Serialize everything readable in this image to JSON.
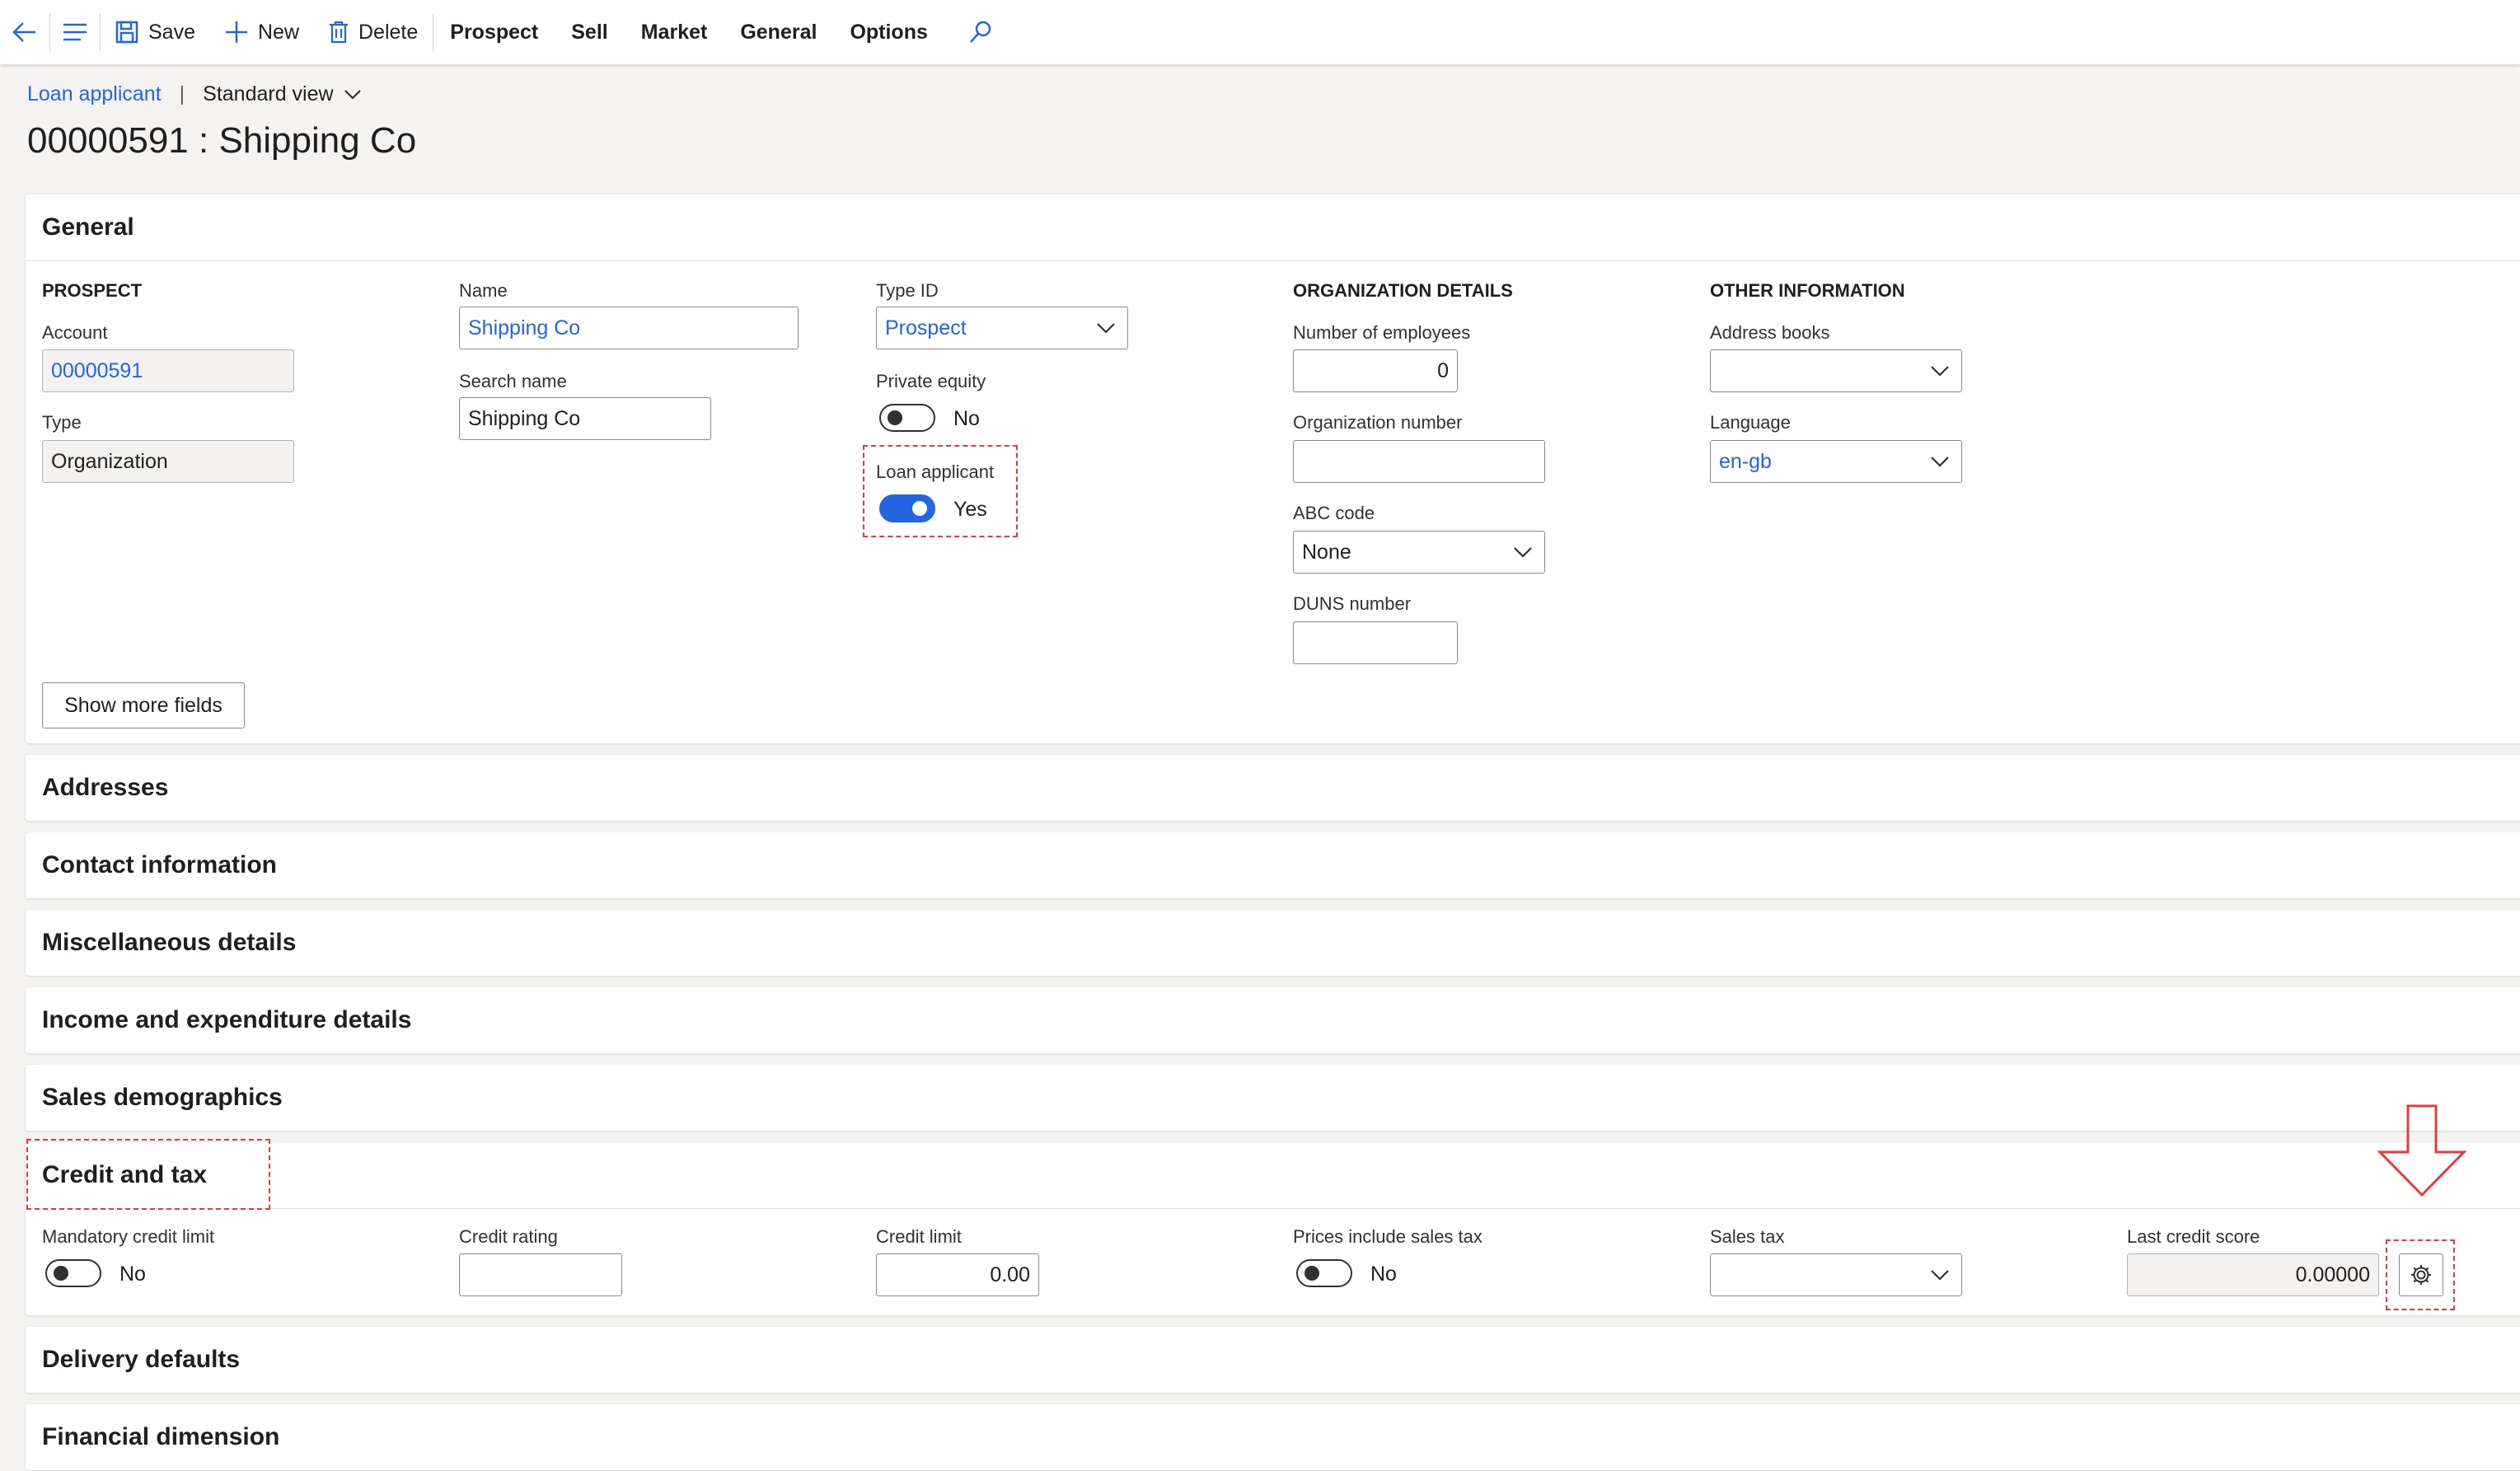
{
  "actionbar": {
    "save": "Save",
    "new": "New",
    "delete": "Delete",
    "menus": [
      "Prospect",
      "Sell",
      "Market",
      "General",
      "Options"
    ]
  },
  "breadcrumb": {
    "link": "Loan applicant",
    "separator": "|",
    "view": "Standard view"
  },
  "title": "00000591 : Shipping Co",
  "general": {
    "header": "General",
    "prospect_heading": "PROSPECT",
    "account_label": "Account",
    "account_value": "00000591",
    "type_label": "Type",
    "type_value": "Organization",
    "name_label": "Name",
    "name_value": "Shipping Co",
    "search_name_label": "Search name",
    "search_name_value": "Shipping Co",
    "type_id_label": "Type ID",
    "type_id_value": "Prospect",
    "private_equity_label": "Private equity",
    "private_equity_value": "No",
    "loan_applicant_label": "Loan applicant",
    "loan_applicant_value": "Yes",
    "org_heading": "ORGANIZATION DETAILS",
    "employees_label": "Number of employees",
    "employees_value": "0",
    "org_number_label": "Organization number",
    "org_number_value": "",
    "abc_label": "ABC code",
    "abc_value": "None",
    "duns_label": "DUNS number",
    "duns_value": "",
    "other_heading": "OTHER INFORMATION",
    "address_books_label": "Address books",
    "address_books_value": "",
    "language_label": "Language",
    "language_value": "en-gb",
    "show_more": "Show more fields"
  },
  "collapsed_tabs": {
    "addresses": "Addresses",
    "contact": "Contact information",
    "misc": "Miscellaneous details",
    "income": "Income and expenditure details",
    "sales_demo": "Sales demographics"
  },
  "credit": {
    "header": "Credit and tax",
    "mandatory_label": "Mandatory credit limit",
    "mandatory_value": "No",
    "rating_label": "Credit rating",
    "rating_value": "",
    "limit_label": "Credit limit",
    "limit_value": "0.00",
    "prices_tax_label": "Prices include sales tax",
    "prices_tax_value": "No",
    "sales_tax_label": "Sales tax",
    "sales_tax_value": "",
    "score_label": "Last credit score",
    "score_value": "0.00000"
  },
  "tail_tabs": {
    "delivery": "Delivery defaults",
    "financial": "Financial dimension"
  },
  "colors": {
    "accent": "#2266e3",
    "highlight": "#e8393c"
  }
}
